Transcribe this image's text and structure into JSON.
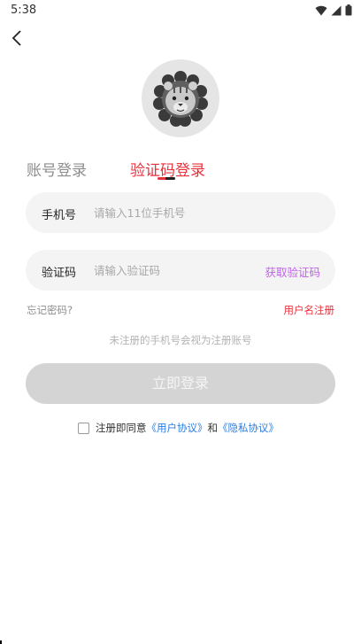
{
  "status_bar": {
    "time": "5:38",
    "icons": [
      "wifi-icon",
      "signal-icon",
      "battery-icon"
    ]
  },
  "nav": {
    "back_icon": "chevron-left-icon"
  },
  "avatar": {
    "icon": "lion-icon"
  },
  "tabs": [
    {
      "label": "账号登录",
      "active": false
    },
    {
      "label": "验证码登录",
      "active": true
    }
  ],
  "form": {
    "phone": {
      "label": "手机号",
      "placeholder": "请输入11位手机号",
      "value": ""
    },
    "code": {
      "label": "验证码",
      "placeholder": "请输入验证码",
      "value": "",
      "get_code": "获取验证码"
    }
  },
  "links": {
    "forgot": "忘记密码?",
    "register": "用户名注册"
  },
  "hint": "未注册的手机号会视为注册账号",
  "login_button": "立即登录",
  "agreement": {
    "checked": false,
    "prefix": "注册即同意",
    "user_agreement": "《用户协议》",
    "and": "和",
    "privacy_policy": "《隐私协议》"
  },
  "colors": {
    "accent_red": "#e8323c",
    "get_code_purple": "#c062e8",
    "link_blue": "#2d7de0",
    "button_disabled": "#d4d4d4"
  }
}
